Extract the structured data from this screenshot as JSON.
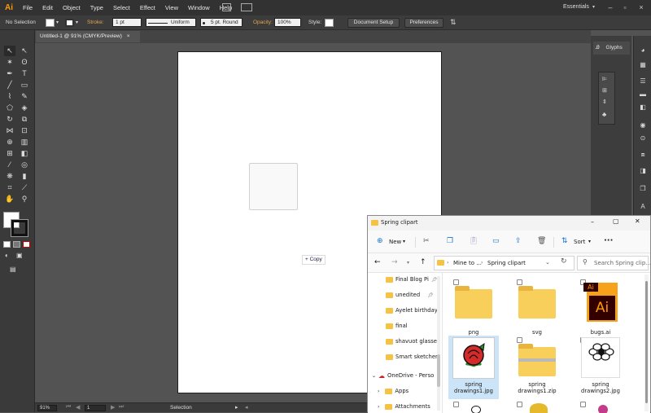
{
  "app": {
    "logo": "Ai"
  },
  "menu": [
    "File",
    "Edit",
    "Object",
    "Type",
    "Select",
    "Effect",
    "View",
    "Window",
    "Help"
  ],
  "workspace": "Essentials",
  "control_bar": {
    "selection": "No Selection",
    "stroke_label": "Stroke:",
    "stroke_weight": "1 pt",
    "stroke_profile": "Uniform",
    "brush": "5 pt. Round",
    "opacity_label": "Opacity:",
    "opacity_value": "100%",
    "style_label": "Style:",
    "document_setup": "Document Setup",
    "preferences": "Preferences"
  },
  "doc_tab": {
    "title": "Untitled-1 @ 91% (CMYK/Preview)",
    "close": "×"
  },
  "canvas": {
    "copy_label": "Copy"
  },
  "status_bar": {
    "zoom": "91%",
    "artboard": "1",
    "tool": "Selection"
  },
  "panels": {
    "glyphs": "Glyphs"
  },
  "explorer": {
    "title": "Spring clipart",
    "toolbar": {
      "new": "New",
      "sort": "Sort",
      "more": "···"
    },
    "breadcrumb": [
      "Mine to ...",
      "Spring clipart"
    ],
    "search_placeholder": "Search Spring clip...",
    "nav_items": [
      {
        "label": "Final Blog Pi",
        "pinned": true
      },
      {
        "label": "unedited",
        "pinned": true
      },
      {
        "label": "Ayelet birthday",
        "pinned": false
      },
      {
        "label": "final",
        "pinned": false
      },
      {
        "label": "shavuot glasses",
        "pinned": false
      },
      {
        "label": "Smart sketcher",
        "pinned": false
      },
      {
        "label": "OneDrive - Perso",
        "pinned": false
      },
      {
        "label": "Apps",
        "pinned": false
      },
      {
        "label": "Attachments",
        "pinned": false
      }
    ],
    "files": [
      {
        "name": "png",
        "type": "folder",
        "selected": false
      },
      {
        "name": "svg",
        "type": "folder",
        "selected": false
      },
      {
        "name": "bugs.ai",
        "type": "ai",
        "selected": false
      },
      {
        "name": "spring drawings1.jpg",
        "type": "rose",
        "selected": true
      },
      {
        "name": "spring drawings1.zip",
        "type": "zip",
        "selected": false
      },
      {
        "name": "spring drawings2.jpg",
        "type": "flower",
        "selected": false
      }
    ]
  }
}
